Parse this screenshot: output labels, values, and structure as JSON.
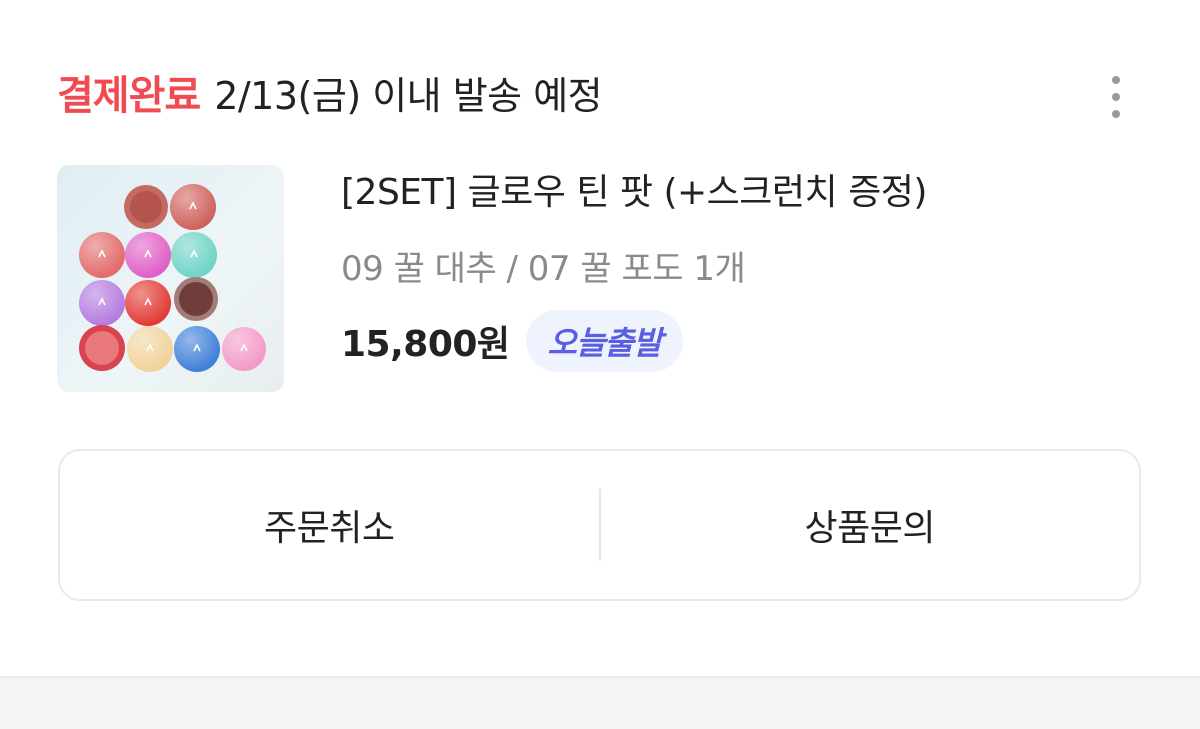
{
  "order": {
    "status": "결제완료",
    "shipping_note": "2/13(금) 이내 발송 예정"
  },
  "product": {
    "title": "[2SET] 글로우 틴 팟 (+스크런치 증정)",
    "option": "09 꿀 대추 / 07 꿀 포도 1개",
    "price": "15,800원",
    "badge": "오늘출발",
    "image_icon": "product-thumbnail"
  },
  "actions": {
    "cancel_label": "주문취소",
    "inquiry_label": "상품문의"
  },
  "colors": {
    "status_red": "#f04b52",
    "badge_text": "#5a5ee0",
    "badge_bg": "#eef3fd"
  }
}
